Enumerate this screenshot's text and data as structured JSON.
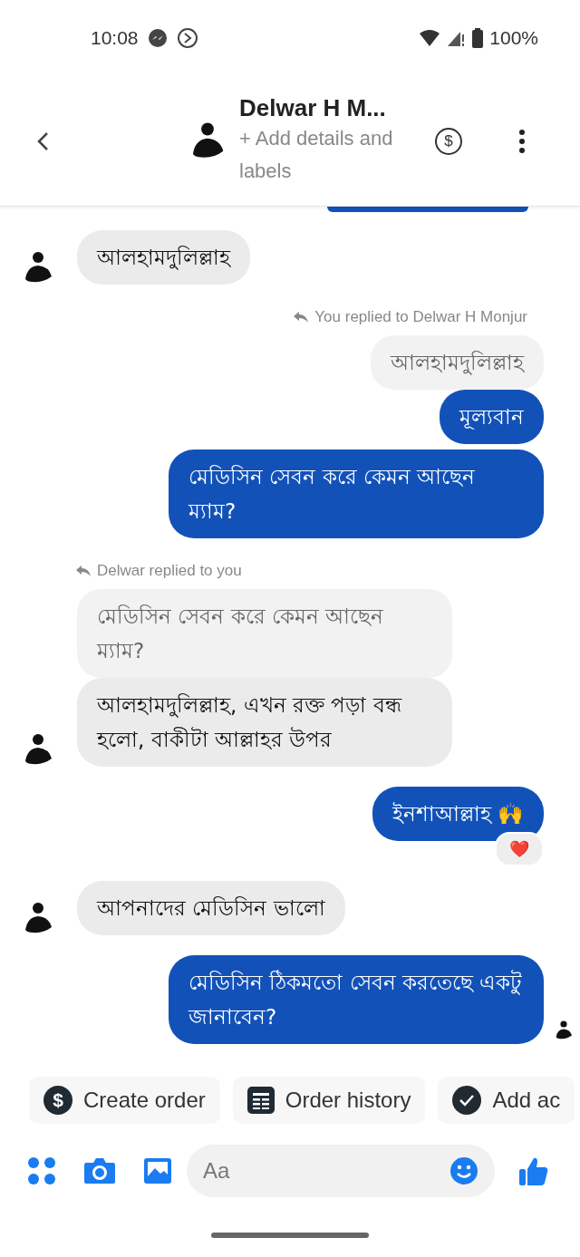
{
  "status_bar": {
    "time": "10:08",
    "battery": "100%"
  },
  "header": {
    "name": "Delwar H M...",
    "subtitle": "+ Add details and labels",
    "payment_symbol": "$"
  },
  "messages": [
    {
      "kind": "clipped"
    },
    {
      "kind": "incoming",
      "text": "আলহামদুলিল্লাহ",
      "avatar": true
    },
    {
      "kind": "reply_note_out",
      "text": "You replied to Delwar H Monjur"
    },
    {
      "kind": "quote_out",
      "text": "আলহামদুলিল্লাহ"
    },
    {
      "kind": "outgoing",
      "text": "মূল্যবান"
    },
    {
      "kind": "outgoing",
      "text": "মেডিসিন সেবন করে কেমন আছেন ম্যাম?"
    },
    {
      "kind": "reply_note_in",
      "text": "Delwar replied to you"
    },
    {
      "kind": "quote_in",
      "text": "মেডিসিন সেবন করে কেমন আছেন ম্যাম?"
    },
    {
      "kind": "incoming",
      "text": "আলহামদুলিল্লাহ, এখন রক্ত পড়া বন্ধ হলো, বাকীটা আল্লাহর উপর",
      "avatar": true
    },
    {
      "kind": "outgoing",
      "text": "ইনশাআল্লাহ 🙌",
      "reaction": "❤️"
    },
    {
      "kind": "incoming",
      "text": "আপনাদের মেডিসিন ভালো",
      "avatar": true
    },
    {
      "kind": "outgoing",
      "text": "মেডিসিন ঠিকমতো সেবন করতেছে একটু জানাবেন?",
      "seen": true
    }
  ],
  "actions": [
    {
      "label": "Create order",
      "symbol": "$"
    },
    {
      "label": "Order history"
    },
    {
      "label": "Add ac"
    }
  ],
  "composer": {
    "placeholder": "Aa"
  }
}
